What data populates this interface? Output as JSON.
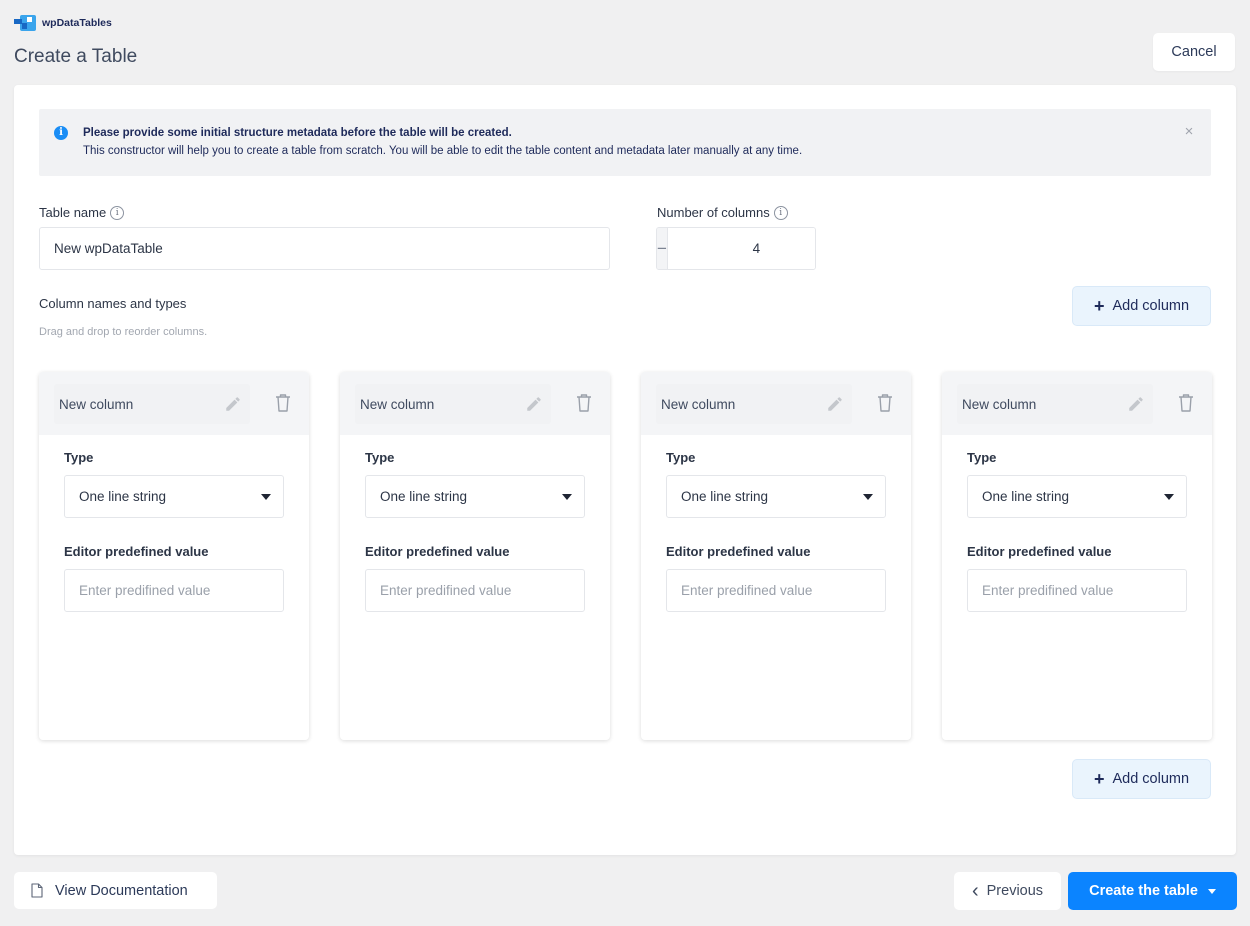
{
  "header": {
    "brand": "wpDataTables",
    "title": "Create a Table",
    "cancel_label": "Cancel"
  },
  "alert": {
    "icon": "info-icon",
    "title": "Please provide some initial structure metadata before the table will be created.",
    "text": "This constructor will help you to create a table from scratch. You will be able to edit the table content and metadata later manually at any time.",
    "close_glyph": "×"
  },
  "form": {
    "table_name_label": "Table name",
    "table_name_value": "New wpDataTable",
    "num_columns_label": "Number of columns",
    "num_columns_value": "4",
    "minus_glyph": "−",
    "plus_glyph": "+",
    "info_glyph": "i",
    "section_title": "Column names and types",
    "hint": "Drag and drop to reorder columns.",
    "add_column_label": "Add column",
    "add_column_glyph": "+"
  },
  "columns": [
    {
      "name": "New column",
      "type_label": "Type",
      "type_value": "One line string",
      "predefined_label": "Editor predefined value",
      "predefined_placeholder": "Enter predifined value",
      "predefined_value": ""
    },
    {
      "name": "New column",
      "type_label": "Type",
      "type_value": "One line string",
      "predefined_label": "Editor predefined value",
      "predefined_placeholder": "Enter predifined value",
      "predefined_value": ""
    },
    {
      "name": "New column",
      "type_label": "Type",
      "type_value": "One line string",
      "predefined_label": "Editor predefined value",
      "predefined_placeholder": "Enter predifined value",
      "predefined_value": ""
    },
    {
      "name": "New column",
      "type_label": "Type",
      "type_value": "One line string",
      "predefined_label": "Editor predefined value",
      "predefined_placeholder": "Enter predifined value",
      "predefined_value": ""
    }
  ],
  "footer": {
    "docs_label": "View Documentation",
    "previous_label": "Previous",
    "previous_glyph": "‹",
    "create_label": "Create the table"
  },
  "colors": {
    "accent": "#0b84ff",
    "info": "#1a8df5",
    "add_button_bg": "#eaf4fd",
    "background": "#f0f0f1"
  }
}
